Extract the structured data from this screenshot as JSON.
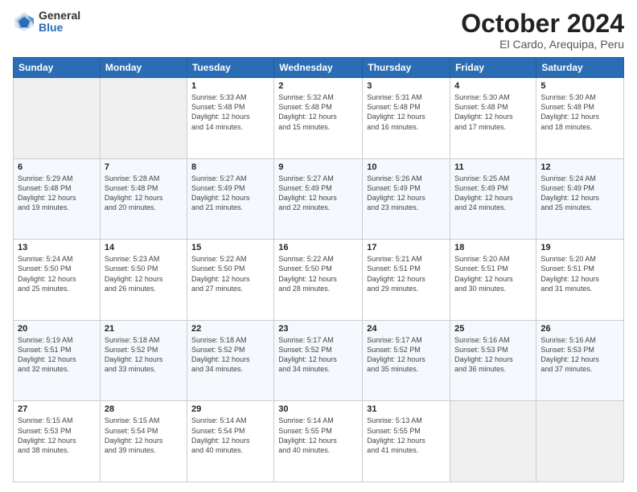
{
  "header": {
    "logo_general": "General",
    "logo_blue": "Blue",
    "month_title": "October 2024",
    "location": "El Cardo, Arequipa, Peru"
  },
  "weekdays": [
    "Sunday",
    "Monday",
    "Tuesday",
    "Wednesday",
    "Thursday",
    "Friday",
    "Saturday"
  ],
  "weeks": [
    [
      {
        "day": null
      },
      {
        "day": null
      },
      {
        "day": "1",
        "sunrise": "5:33 AM",
        "sunset": "5:48 PM",
        "daylight": "12 hours and 14 minutes."
      },
      {
        "day": "2",
        "sunrise": "5:32 AM",
        "sunset": "5:48 PM",
        "daylight": "12 hours and 15 minutes."
      },
      {
        "day": "3",
        "sunrise": "5:31 AM",
        "sunset": "5:48 PM",
        "daylight": "12 hours and 16 minutes."
      },
      {
        "day": "4",
        "sunrise": "5:30 AM",
        "sunset": "5:48 PM",
        "daylight": "12 hours and 17 minutes."
      },
      {
        "day": "5",
        "sunrise": "5:30 AM",
        "sunset": "5:48 PM",
        "daylight": "12 hours and 18 minutes."
      }
    ],
    [
      {
        "day": "6",
        "sunrise": "5:29 AM",
        "sunset": "5:48 PM",
        "daylight": "12 hours and 19 minutes."
      },
      {
        "day": "7",
        "sunrise": "5:28 AM",
        "sunset": "5:48 PM",
        "daylight": "12 hours and 20 minutes."
      },
      {
        "day": "8",
        "sunrise": "5:27 AM",
        "sunset": "5:49 PM",
        "daylight": "12 hours and 21 minutes."
      },
      {
        "day": "9",
        "sunrise": "5:27 AM",
        "sunset": "5:49 PM",
        "daylight": "12 hours and 22 minutes."
      },
      {
        "day": "10",
        "sunrise": "5:26 AM",
        "sunset": "5:49 PM",
        "daylight": "12 hours and 23 minutes."
      },
      {
        "day": "11",
        "sunrise": "5:25 AM",
        "sunset": "5:49 PM",
        "daylight": "12 hours and 24 minutes."
      },
      {
        "day": "12",
        "sunrise": "5:24 AM",
        "sunset": "5:49 PM",
        "daylight": "12 hours and 25 minutes."
      }
    ],
    [
      {
        "day": "13",
        "sunrise": "5:24 AM",
        "sunset": "5:50 PM",
        "daylight": "12 hours and 25 minutes."
      },
      {
        "day": "14",
        "sunrise": "5:23 AM",
        "sunset": "5:50 PM",
        "daylight": "12 hours and 26 minutes."
      },
      {
        "day": "15",
        "sunrise": "5:22 AM",
        "sunset": "5:50 PM",
        "daylight": "12 hours and 27 minutes."
      },
      {
        "day": "16",
        "sunrise": "5:22 AM",
        "sunset": "5:50 PM",
        "daylight": "12 hours and 28 minutes."
      },
      {
        "day": "17",
        "sunrise": "5:21 AM",
        "sunset": "5:51 PM",
        "daylight": "12 hours and 29 minutes."
      },
      {
        "day": "18",
        "sunrise": "5:20 AM",
        "sunset": "5:51 PM",
        "daylight": "12 hours and 30 minutes."
      },
      {
        "day": "19",
        "sunrise": "5:20 AM",
        "sunset": "5:51 PM",
        "daylight": "12 hours and 31 minutes."
      }
    ],
    [
      {
        "day": "20",
        "sunrise": "5:19 AM",
        "sunset": "5:51 PM",
        "daylight": "12 hours and 32 minutes."
      },
      {
        "day": "21",
        "sunrise": "5:18 AM",
        "sunset": "5:52 PM",
        "daylight": "12 hours and 33 minutes."
      },
      {
        "day": "22",
        "sunrise": "5:18 AM",
        "sunset": "5:52 PM",
        "daylight": "12 hours and 34 minutes."
      },
      {
        "day": "23",
        "sunrise": "5:17 AM",
        "sunset": "5:52 PM",
        "daylight": "12 hours and 34 minutes."
      },
      {
        "day": "24",
        "sunrise": "5:17 AM",
        "sunset": "5:52 PM",
        "daylight": "12 hours and 35 minutes."
      },
      {
        "day": "25",
        "sunrise": "5:16 AM",
        "sunset": "5:53 PM",
        "daylight": "12 hours and 36 minutes."
      },
      {
        "day": "26",
        "sunrise": "5:16 AM",
        "sunset": "5:53 PM",
        "daylight": "12 hours and 37 minutes."
      }
    ],
    [
      {
        "day": "27",
        "sunrise": "5:15 AM",
        "sunset": "5:53 PM",
        "daylight": "12 hours and 38 minutes."
      },
      {
        "day": "28",
        "sunrise": "5:15 AM",
        "sunset": "5:54 PM",
        "daylight": "12 hours and 39 minutes."
      },
      {
        "day": "29",
        "sunrise": "5:14 AM",
        "sunset": "5:54 PM",
        "daylight": "12 hours and 40 minutes."
      },
      {
        "day": "30",
        "sunrise": "5:14 AM",
        "sunset": "5:55 PM",
        "daylight": "12 hours and 40 minutes."
      },
      {
        "day": "31",
        "sunrise": "5:13 AM",
        "sunset": "5:55 PM",
        "daylight": "12 hours and 41 minutes."
      },
      {
        "day": null
      },
      {
        "day": null
      }
    ]
  ],
  "labels": {
    "sunrise_prefix": "Sunrise: ",
    "sunset_prefix": "Sunset: ",
    "daylight_prefix": "Daylight: "
  }
}
